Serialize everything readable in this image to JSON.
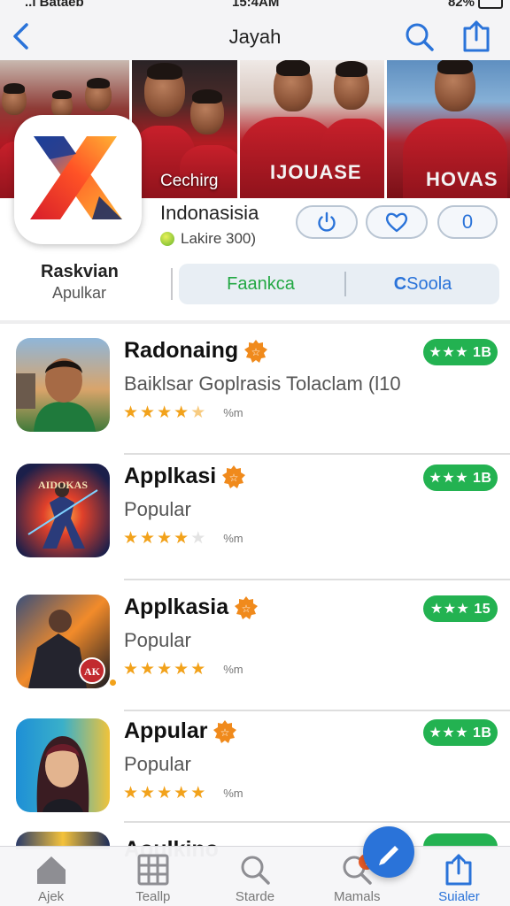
{
  "status_bar": {
    "carrier": "..l Bataeb",
    "time": "15:4AM",
    "battery": "82%"
  },
  "nav": {
    "title": "Jayah"
  },
  "hero": {
    "caption": "Cechirg"
  },
  "app": {
    "name": "Indonasisia",
    "subtitle": "Lakire 300)",
    "action_count": "0",
    "developer": "Raskvian",
    "developer_sub": "Apulkar"
  },
  "segment": {
    "left_label": "Faankca",
    "right_label": "Soola"
  },
  "list": [
    {
      "title": "Radonaing",
      "subtitle": "Baiklsar Goplrasis Tolaclam (l10",
      "stars": 4.5,
      "count_label": "%m",
      "rating_label": "★★★ 1B",
      "thumb": "soccer-player-stadium"
    },
    {
      "title": "Applkasi",
      "subtitle": "Popular",
      "stars": 4,
      "count_label": "%m",
      "rating_label": "★★★ 1B",
      "thumb": "action-game-character",
      "thumb_text": "AIDOKAS"
    },
    {
      "title": "Applkasia",
      "subtitle": "Popular",
      "stars": 5,
      "count_label": "%m",
      "rating_label": "★★★ 15",
      "thumb": "dark-hero",
      "thumb_text": "AK"
    },
    {
      "title": "Appular",
      "subtitle": "Popular",
      "stars": 5,
      "count_label": "%m",
      "rating_label": "★★★ 1B",
      "thumb": "woman-portrait"
    }
  ],
  "peek": {
    "title": "Aoulkino"
  },
  "tabs": [
    {
      "label": "Ajek",
      "icon": "house-icon"
    },
    {
      "label": "Teallp",
      "icon": "grid-icon"
    },
    {
      "label": "Starde",
      "icon": "search-icon"
    },
    {
      "label": "Mamals",
      "icon": "search-badge-icon",
      "badge": "?"
    },
    {
      "label": "Suialer",
      "icon": "share-icon",
      "active": true
    }
  ],
  "colors": {
    "accent": "#2a73d9",
    "green": "#23b251",
    "star": "#f2a21b",
    "badge": "#e85b27"
  }
}
